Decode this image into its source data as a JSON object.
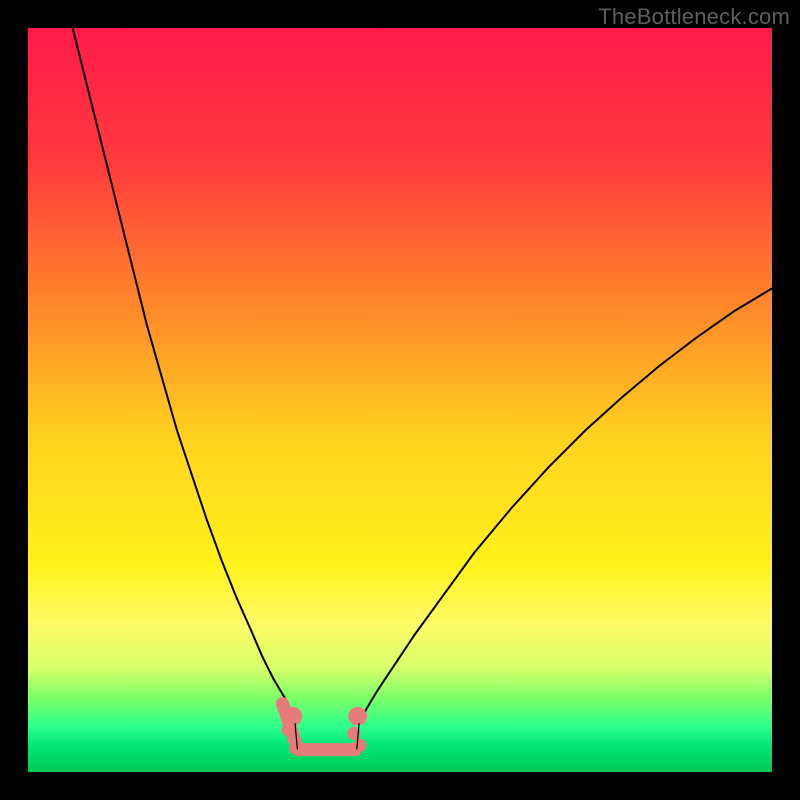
{
  "watermark": "TheBottleneck.com",
  "chart_data": {
    "type": "line",
    "title": "",
    "xlabel": "",
    "ylabel": "",
    "xlim": [
      0,
      100
    ],
    "ylim": [
      0,
      100
    ],
    "grid": false,
    "legend": false,
    "gradient_stops": [
      {
        "offset": 0.0,
        "color": "#ff1a4b"
      },
      {
        "offset": 0.18,
        "color": "#ff3a3d"
      },
      {
        "offset": 0.38,
        "color": "#ff8a2a"
      },
      {
        "offset": 0.55,
        "color": "#ffd21f"
      },
      {
        "offset": 0.72,
        "color": "#fff21a"
      },
      {
        "offset": 0.8,
        "color": "#fffc66"
      },
      {
        "offset": 0.86,
        "color": "#d8ff6a"
      },
      {
        "offset": 0.9,
        "color": "#7dff67"
      },
      {
        "offset": 0.94,
        "color": "#2bff8f"
      },
      {
        "offset": 0.965,
        "color": "#00e676"
      },
      {
        "offset": 1.0,
        "color": "#00c853"
      }
    ],
    "series": [
      {
        "name": "left-curve",
        "x": [
          6,
          8,
          10,
          12,
          14,
          16,
          18,
          20,
          22,
          24,
          26,
          28,
          30,
          31.5,
          33,
          34.5,
          35,
          35.9
        ],
        "values": [
          100,
          92,
          84,
          76,
          68,
          60,
          53,
          46,
          40,
          34,
          28.5,
          23.5,
          19,
          15.5,
          12.5,
          10,
          8.5,
          6.5
        ]
      },
      {
        "name": "right-curve",
        "x": [
          44.5,
          45.5,
          47,
          49,
          52,
          56,
          60,
          65,
          70,
          75,
          80,
          85,
          90,
          95,
          100
        ],
        "values": [
          6.5,
          8.5,
          11,
          14,
          18.5,
          24,
          29.5,
          35.5,
          41,
          46,
          50.5,
          54.7,
          58.5,
          62,
          65
        ]
      }
    ],
    "markers": [
      {
        "cx": 35.6,
        "cy": 7.5,
        "r": 1.4,
        "type": "end"
      },
      {
        "cx": 35.0,
        "cy": 5.7,
        "r": 1.0,
        "type": "dot"
      },
      {
        "cx": 35.7,
        "cy": 4.5,
        "r": 1.0,
        "type": "dot"
      },
      {
        "cx": 36.0,
        "cy": 3.3,
        "r": 1.0,
        "type": "dot"
      },
      {
        "cx": 44.3,
        "cy": 7.5,
        "r": 1.4,
        "type": "end"
      },
      {
        "cx": 43.8,
        "cy": 5.2,
        "r": 1.0,
        "type": "dot"
      },
      {
        "cx": 44.6,
        "cy": 3.6,
        "r": 1.0,
        "type": "dot"
      }
    ],
    "bottom_segment": {
      "x1": 36.3,
      "x2": 44.0,
      "y": 3.0
    },
    "left_tail": {
      "x1": 34.2,
      "x2": 36.2,
      "y1": 9.2,
      "y2": 3.2
    },
    "marker_color": "#e77a7a",
    "curve_color": "#000000",
    "curve_width_main": 2.0,
    "curve_width_tail": 2.2
  }
}
